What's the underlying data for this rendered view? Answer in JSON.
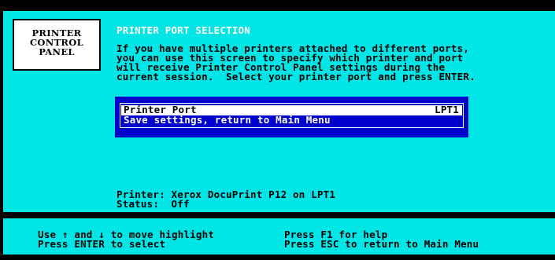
{
  "panel_label": {
    "lines": [
      "PRINTER",
      "CONTROL",
      "PANEL"
    ]
  },
  "screen": {
    "title": "PRINTER PORT SELECTION",
    "description": [
      "If you have multiple printers attached to different ports,",
      "you can use this screen to specify which printer and port",
      "will receive Printer Control Panel settings during the",
      "current session.  Select your printer port and press ENTER."
    ]
  },
  "menu": {
    "items": [
      {
        "label": "Printer Port",
        "value": "LPT1",
        "highlighted": true
      },
      {
        "label": "Save settings, return to Main Menu",
        "value": "",
        "highlighted": false
      }
    ]
  },
  "status": {
    "printer_line": "Printer: Xerox DocuPrint P12 on LPT1",
    "status_line": "Status:  Off"
  },
  "help_bar": {
    "left_line1": "Use ↑ and ↓ to move highlight",
    "left_line2": "Press ENTER to select",
    "right_line1": "Press F1 for help",
    "right_line2": "Press ESC to return to Main Menu"
  },
  "colors": {
    "panel_background": "#00e6e6",
    "menu_background": "#0000cc",
    "screen_background": "#000000",
    "title_text": "#ffffff"
  }
}
